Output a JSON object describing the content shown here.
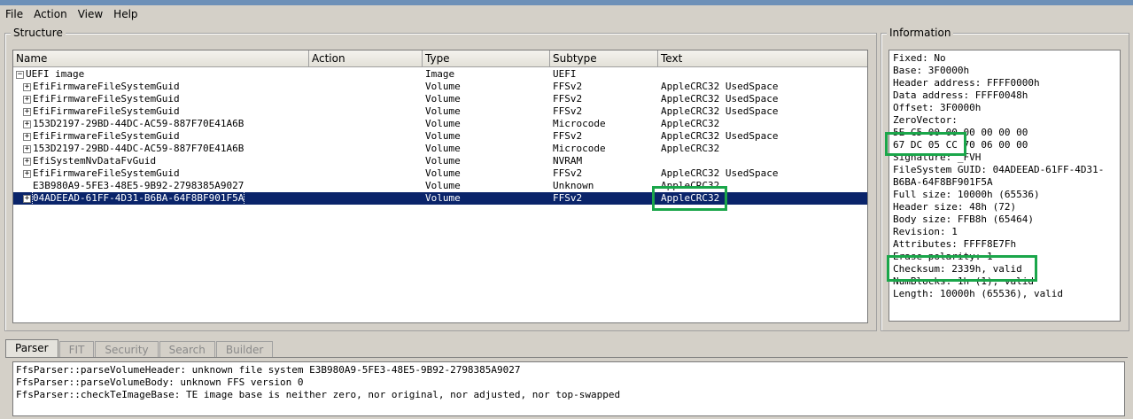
{
  "menu": [
    "File",
    "Action",
    "View",
    "Help"
  ],
  "structure": {
    "title": "Structure",
    "columns": [
      "Name",
      "Action",
      "Type",
      "Subtype",
      "Text"
    ],
    "rows": [
      {
        "name": "UEFI image",
        "action": "",
        "type": "Image",
        "subtype": "UEFI",
        "text": ""
      },
      {
        "name": "EfiFirmwareFileSystemGuid",
        "action": "",
        "type": "Volume",
        "subtype": "FFSv2",
        "text": "AppleCRC32 UsedSpace"
      },
      {
        "name": "EfiFirmwareFileSystemGuid",
        "action": "",
        "type": "Volume",
        "subtype": "FFSv2",
        "text": "AppleCRC32 UsedSpace"
      },
      {
        "name": "EfiFirmwareFileSystemGuid",
        "action": "",
        "type": "Volume",
        "subtype": "FFSv2",
        "text": "AppleCRC32 UsedSpace"
      },
      {
        "name": "153D2197-29BD-44DC-AC59-887F70E41A6B",
        "action": "",
        "type": "Volume",
        "subtype": "Microcode",
        "text": "AppleCRC32"
      },
      {
        "name": "EfiFirmwareFileSystemGuid",
        "action": "",
        "type": "Volume",
        "subtype": "FFSv2",
        "text": "AppleCRC32 UsedSpace"
      },
      {
        "name": "153D2197-29BD-44DC-AC59-887F70E41A6B",
        "action": "",
        "type": "Volume",
        "subtype": "Microcode",
        "text": "AppleCRC32"
      },
      {
        "name": "EfiSystemNvDataFvGuid",
        "action": "",
        "type": "Volume",
        "subtype": "NVRAM",
        "text": ""
      },
      {
        "name": "EfiFirmwareFileSystemGuid",
        "action": "",
        "type": "Volume",
        "subtype": "FFSv2",
        "text": "AppleCRC32 UsedSpace"
      },
      {
        "name": "E3B980A9-5FE3-48E5-9B92-2798385A9027",
        "action": "",
        "type": "Volume",
        "subtype": "Unknown",
        "text": "AppleCRC32"
      },
      {
        "name": "04ADEEAD-61FF-4D31-B6BA-64F8BF901F5A",
        "action": "",
        "type": "Volume",
        "subtype": "FFSv2",
        "text": "AppleCRC32"
      }
    ]
  },
  "information": {
    "title": "Information",
    "lines": [
      "Fixed: No",
      "Base: 3F0000h",
      "Header address: FFFF0000h",
      "Data address: FFFF0048h",
      "Offset: 3F0000h",
      "ZeroVector:",
      "5E C5 00 00 00 00 00 00",
      "67 DC 05 CC 70 06 00 00",
      "Signature: _FVH",
      "FileSystem GUID: 04ADEEAD-61FF-4D31-",
      "B6BA-64F8BF901F5A",
      "Full size: 10000h (65536)",
      "Header size: 48h (72)",
      "Body size: FFB8h (65464)",
      "Revision: 1",
      "Attributes: FFFF8E7Fh",
      "Erase polarity: 1",
      "Checksum: 2339h, valid",
      "NumBlocks: 1h (1), valid",
      "Length: 10000h (65536), valid"
    ]
  },
  "tabs": [
    "Parser",
    "FIT",
    "Security",
    "Search",
    "Builder"
  ],
  "messages": [
    "FfsParser::parseVolumeHeader: unknown file system E3B980A9-5FE3-48E5-9B92-2798385A9027",
    "FfsParser::parseVolumeBody: unknown FFS version 0",
    "FfsParser::checkTeImageBase: TE image base is neither zero, nor original, nor adjusted, nor top-swapped"
  ],
  "colors": {
    "highlight": "#1aa64a",
    "selection": "#0a246a"
  }
}
